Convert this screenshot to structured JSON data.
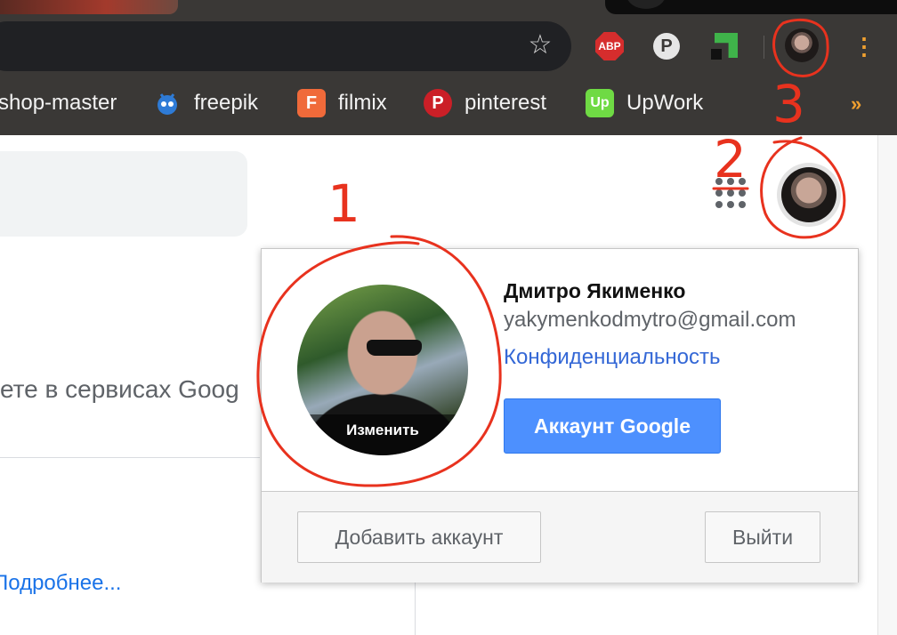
{
  "toolbar": {
    "star_icon": "bookmark-star-icon",
    "extensions": [
      {
        "name": "adblock",
        "label": "ABP"
      },
      {
        "name": "pinterest",
        "label": "P"
      },
      {
        "name": "green-extension",
        "label": ""
      }
    ],
    "menu_icon": "kebab-menu-icon"
  },
  "bookmarks": [
    {
      "label": "shop-master",
      "icon": ""
    },
    {
      "label": "freepik",
      "icon": "freepik-icon"
    },
    {
      "label": "filmix",
      "icon": "F"
    },
    {
      "label": "pinterest",
      "icon": "P"
    },
    {
      "label": "UpWork",
      "icon": "Up"
    }
  ],
  "bookmarks_more": "»",
  "page": {
    "text": "ете в сервисах Goog",
    "link": "Подробнее..."
  },
  "account_popup": {
    "change_photo": "Изменить",
    "name": "Дмитро Якименко",
    "email": "yakymenkodmytro@gmail.com",
    "privacy_link": "Конфиденциальность",
    "account_button": "Аккаунт Google",
    "add_account_button": "Добавить аккаунт",
    "logout_button": "Выйти"
  },
  "annotations": [
    "1",
    "2",
    "3"
  ],
  "colors": {
    "chrome": "#3a3836",
    "annotation": "#e8321e",
    "primary_button": "#4d90fe",
    "link": "#3367d6"
  }
}
